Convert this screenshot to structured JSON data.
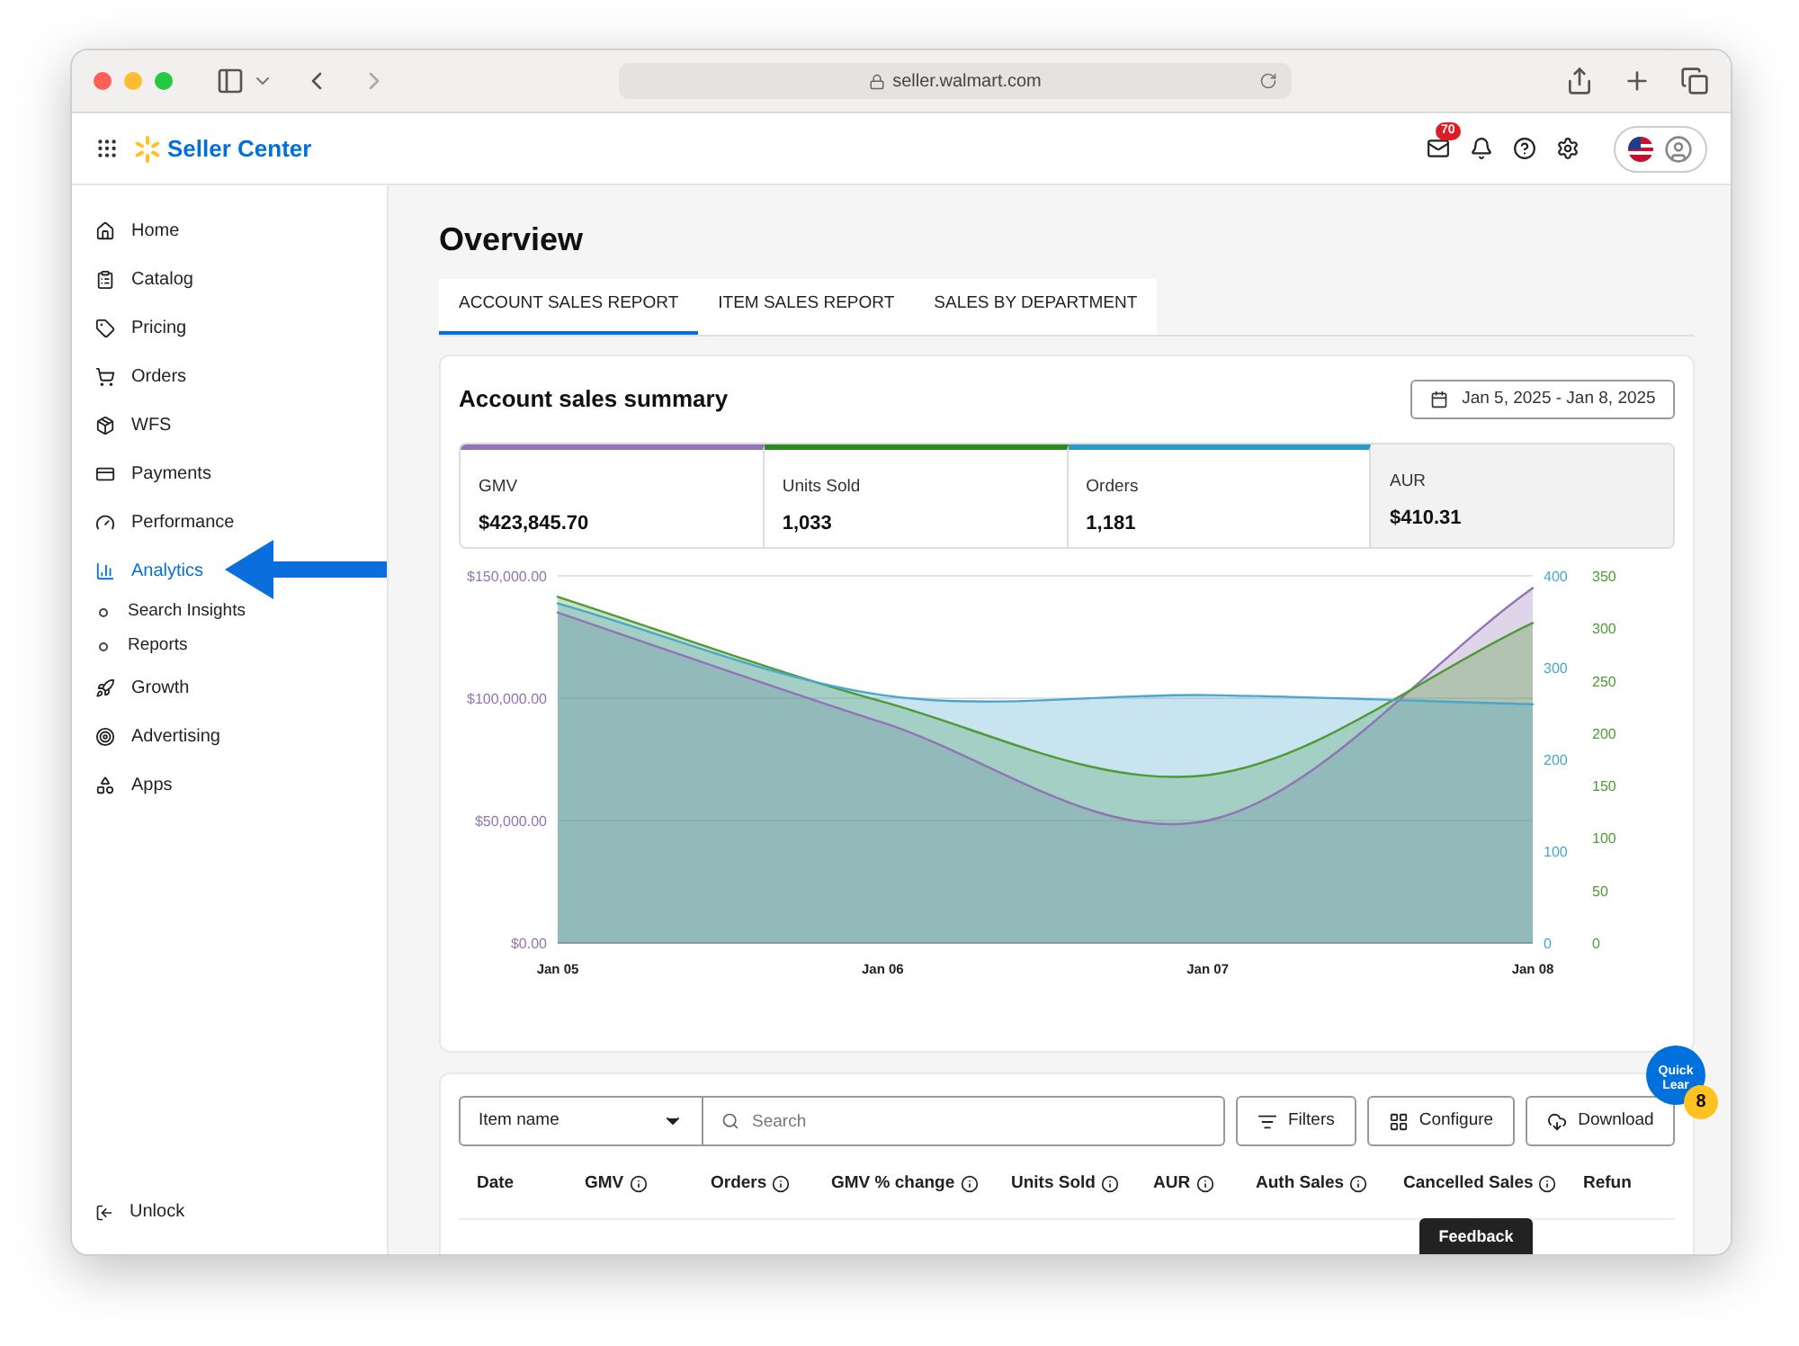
{
  "browser": {
    "url": "seller.walmart.com"
  },
  "header": {
    "brand": "Seller Center",
    "mail_badge": "70"
  },
  "sidebar": {
    "items": [
      {
        "label": "Home",
        "selected": false
      },
      {
        "label": "Catalog",
        "selected": false
      },
      {
        "label": "Pricing",
        "selected": false
      },
      {
        "label": "Orders",
        "selected": false
      },
      {
        "label": "WFS",
        "selected": false
      },
      {
        "label": "Payments",
        "selected": false
      },
      {
        "label": "Performance",
        "selected": false
      },
      {
        "label": "Analytics",
        "selected": true,
        "children": [
          {
            "label": "Search Insights",
            "selected": false
          },
          {
            "label": "Reports",
            "selected": false
          }
        ]
      },
      {
        "label": "Growth",
        "selected": false
      },
      {
        "label": "Advertising",
        "selected": false
      },
      {
        "label": "Apps",
        "selected": false
      }
    ],
    "footer": "Unlock"
  },
  "page": {
    "title": "Overview",
    "tabs": [
      {
        "label": "ACCOUNT SALES REPORT",
        "selected": true
      },
      {
        "label": "ITEM SALES REPORT",
        "selected": false
      },
      {
        "label": "SALES BY DEPARTMENT",
        "selected": false
      }
    ]
  },
  "summary": {
    "title": "Account sales summary",
    "date_range": "Jan 5, 2025 - Jan 8, 2025",
    "metrics": [
      {
        "label": "GMV",
        "value": "$423,845.70",
        "color": "#9274b6",
        "selected": true
      },
      {
        "label": "Units Sold",
        "value": "1,033",
        "color": "#2c8a1f",
        "selected": true
      },
      {
        "label": "Orders",
        "value": "1,181",
        "color": "#2a9ac7",
        "selected": true
      },
      {
        "label": "AUR",
        "value": "$410.31",
        "selected": false
      }
    ],
    "chart_data": {
      "type": "area",
      "categories": [
        "Jan 05",
        "Jan 06",
        "Jan 07",
        "Jan 08"
      ],
      "ylim": [
        0,
        150000
      ],
      "yticks": [
        {
          "value": 0,
          "label": "$0.00"
        },
        {
          "value": 50000,
          "label": "$50,000.00"
        },
        {
          "value": 100000,
          "label": "$100,000.00"
        },
        {
          "value": 150000,
          "label": "$150,000.00"
        }
      ],
      "series": [
        {
          "color": "#9274b6",
          "values": [
            135000,
            90000,
            50000,
            145000
          ]
        },
        {
          "color": "#4f9a35",
          "values": [
            330,
            230,
            160,
            305
          ],
          "axis": "y3"
        },
        {
          "color": "#4aa6cc",
          "values": [
            370,
            270,
            270,
            260
          ],
          "axis": "y2"
        }
      ],
      "y2lim": [
        0,
        400
      ],
      "y2ticks": [
        {
          "value": 0,
          "label": "0"
        },
        {
          "value": 100,
          "label": "100"
        },
        {
          "value": 200,
          "label": "200"
        },
        {
          "value": 300,
          "label": "300"
        },
        {
          "value": 400,
          "label": "400"
        }
      ],
      "y3lim": [
        0,
        350
      ],
      "y3ticks": [
        {
          "value": 0,
          "label": "0"
        },
        {
          "value": 50,
          "label": "50"
        },
        {
          "value": 100,
          "label": "100"
        },
        {
          "value": 150,
          "label": "150"
        },
        {
          "value": 200,
          "label": "200"
        },
        {
          "value": 250,
          "label": "250"
        },
        {
          "value": 300,
          "label": "300"
        },
        {
          "value": 350,
          "label": "350"
        }
      ]
    }
  },
  "table": {
    "filter_select": "Item name",
    "search_placeholder": "Search",
    "buttons": [
      "Filters",
      "Configure",
      "Download"
    ],
    "columns": [
      {
        "label": "Date",
        "info": false
      },
      {
        "label": "GMV",
        "info": true
      },
      {
        "label": "Orders",
        "info": true
      },
      {
        "label": "GMV % change",
        "info": true
      },
      {
        "label": "Units Sold",
        "info": true
      },
      {
        "label": "AUR",
        "info": true
      },
      {
        "label": "Auth Sales",
        "info": true
      },
      {
        "label": "Cancelled Sales",
        "info": true
      },
      {
        "label": "Refun",
        "info": false
      }
    ]
  },
  "quick_learn": {
    "lines": [
      "Quick",
      "Lear"
    ],
    "badge": "8"
  },
  "feedback": "Feedback"
}
